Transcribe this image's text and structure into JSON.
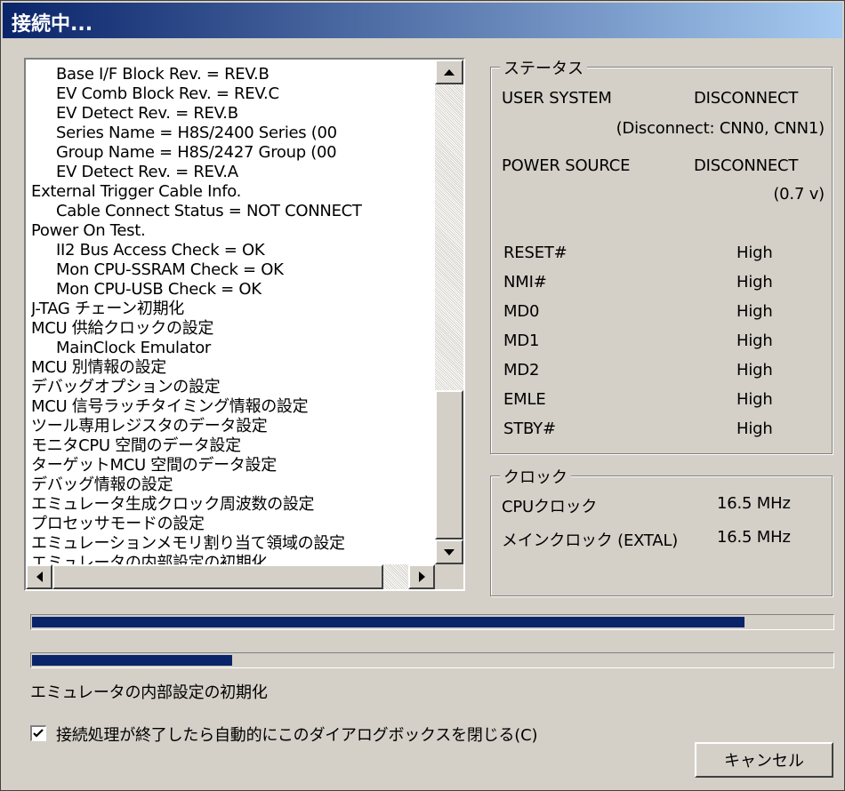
{
  "window": {
    "title": "接続中..."
  },
  "log": {
    "lines": [
      {
        "text": "Base I/F Block Rev.    = REV.B",
        "indent": 1
      },
      {
        "text": "EV Comb Block Rev.     = REV.C",
        "indent": 1
      },
      {
        "text": "EV Detect Rev.         = REV.B",
        "indent": 1
      },
      {
        "text": "Series Name            = H8S/2400 Series (00",
        "indent": 1
      },
      {
        "text": "Group Name             = H8S/2427 Group (00",
        "indent": 1
      },
      {
        "text": "EV Detect Rev.         = REV.A",
        "indent": 1
      },
      {
        "text": "External Trigger Cable Info.",
        "indent": 0
      },
      {
        "text": "Cable Connect Status   = NOT CONNECT",
        "indent": 1
      },
      {
        "text": "Power On Test.",
        "indent": 0
      },
      {
        "text": "II2 Bus Access Check   = OK",
        "indent": 1
      },
      {
        "text": "Mon CPU-SSRAM Check    = OK",
        "indent": 1
      },
      {
        "text": "Mon CPU-USB Check      = OK",
        "indent": 1
      },
      {
        "text": "J-TAG チェーン初期化",
        "indent": 0
      },
      {
        "text": "MCU 供給クロックの設定",
        "indent": 0
      },
      {
        "text": "MainClock Emulator",
        "indent": 1
      },
      {
        "text": "MCU 別情報の設定",
        "indent": 0
      },
      {
        "text": "デバッグオプションの設定",
        "indent": 0
      },
      {
        "text": "MCU 信号ラッチタイミング情報の設定",
        "indent": 0
      },
      {
        "text": "ツール専用レジスタのデータ設定",
        "indent": 0
      },
      {
        "text": "モニタCPU 空間のデータ設定",
        "indent": 0
      },
      {
        "text": "ターゲットMCU 空間のデータ設定",
        "indent": 0
      },
      {
        "text": "デバッグ情報の設定",
        "indent": 0
      },
      {
        "text": "エミュレータ生成クロック周波数の設定",
        "indent": 0
      },
      {
        "text": "プロセッサモードの設定",
        "indent": 0
      },
      {
        "text": "エミュレーションメモリ割り当て領域の設定",
        "indent": 0
      },
      {
        "text": "エミュレータの内部設定の初期化",
        "indent": 0
      }
    ]
  },
  "status": {
    "title": "ステータス",
    "user_system_label": "USER SYSTEM",
    "user_system_value": "DISCONNECT",
    "user_system_detail": "(Disconnect: CNN0, CNN1)",
    "power_source_label": "POWER SOURCE",
    "power_source_value": "DISCONNECT",
    "power_source_detail": "(0.7 v)",
    "signals": [
      {
        "name": "RESET#",
        "value": "High"
      },
      {
        "name": "NMI#",
        "value": "High"
      },
      {
        "name": "MD0",
        "value": "High"
      },
      {
        "name": "MD1",
        "value": "High"
      },
      {
        "name": "MD2",
        "value": "High"
      },
      {
        "name": "EMLE",
        "value": "High"
      },
      {
        "name": "STBY#",
        "value": "High"
      }
    ]
  },
  "clock": {
    "title": "クロック",
    "cpu_label": "CPUクロック",
    "cpu_value": "16.5 MHz",
    "main_label": "メインクロック (EXTAL)",
    "main_value": "16.5 MHz"
  },
  "progress": {
    "overall": 0.89,
    "step": 0.25
  },
  "step_text": "エミュレータの内部設定の初期化",
  "auto_close": {
    "checked": true,
    "label": "接続処理が終了したら自動的にこのダイアログボックスを閉じる(C)"
  },
  "cancel_label": "キャンセル",
  "colors": {
    "title_start": "#0a246a",
    "title_end": "#a6caf0",
    "progress": "#0a246a",
    "face": "#d4d0c8"
  }
}
